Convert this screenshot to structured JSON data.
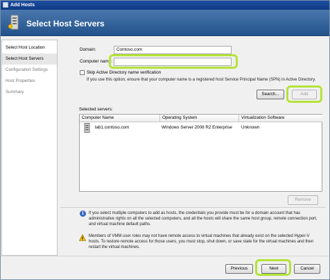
{
  "window": {
    "title": "Add Hosts"
  },
  "banner": {
    "title": "Select Host Servers"
  },
  "nav": {
    "items": [
      {
        "label": "Select Host Location",
        "state": "active"
      },
      {
        "label": "Select Host Servers",
        "state": "selected"
      },
      {
        "label": "Configuration Settings",
        "state": "inactive"
      },
      {
        "label": "Host Properties",
        "state": "inactive"
      },
      {
        "label": "Summary",
        "state": "inactive"
      }
    ]
  },
  "form": {
    "domain_label": "Domain:",
    "domain_value": "Contoso.com",
    "computer_label": "Computer name:",
    "computer_value": "",
    "skip_ad_label": "Skip Active Directory name verification",
    "skip_ad_checked": false,
    "skip_ad_help": "If you use this option, ensure that your computer name is a registered host Service Principal Name (SPN) in Active Directory.",
    "search_button": "Search...",
    "add_button": "Add"
  },
  "selected_servers": {
    "label": "Selected servers:",
    "columns": [
      "Computer Name",
      "Operating System",
      "Virtualization Software"
    ],
    "rows": [
      {
        "computer_name": "lab1.contoso.com",
        "os": "Windows Server 2008 R2 Enterprise",
        "virtualization": "Unknown",
        "icon": "server-icon"
      }
    ],
    "remove_button": "Remove"
  },
  "notes": {
    "info": "If you select multiple computers to add as hosts, the credentials you provide must be for a domain account that has administrative rights on all the selected computers, and all the hosts will share the same host group, remote connection port, and virtual machine default paths.",
    "warning": "Members of VMM user roles may not have remote access to virtual machines that already exist on the selected Hyper-V hosts. To restore remote access for those users, you must stop, shut down, or save state for the virtual machines and then restart the virtual machines."
  },
  "footer": {
    "previous": "Previous",
    "next": "Next",
    "cancel": "Cancel"
  },
  "colors": {
    "highlight": "#b4e33a",
    "banner": "#2f5f98",
    "title_bar": "#1c4fa0"
  }
}
